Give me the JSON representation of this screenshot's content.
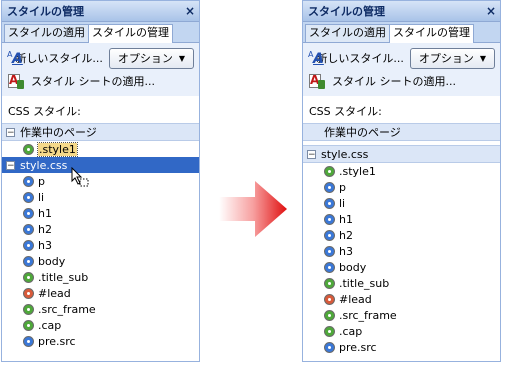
{
  "panel_title": "スタイルの管理",
  "close_symbol": "×",
  "tabs": [
    "スタイルの適用",
    "スタイルの管理"
  ],
  "new_style_label": "新しいスタイル...",
  "options_label": "オプション",
  "apply_stylesheet_label": "スタイル シートの適用...",
  "css_styles_label": "CSS スタイル:",
  "current_page_group": "作業中のページ",
  "stylesheet_group": "style.css",
  "toggle_collapse": "−",
  "colors": {
    "blue": "#3a78d8",
    "green": "#4ea83a",
    "red": "#d85a3a",
    "selection": "#3168c6"
  },
  "left": {
    "current_page_items": [
      {
        "label": ".style1",
        "color": "green"
      }
    ],
    "stylesheet_items": [
      {
        "label": "p",
        "color": "blue"
      },
      {
        "label": "li",
        "color": "blue"
      },
      {
        "label": "h1",
        "color": "blue"
      },
      {
        "label": "h2",
        "color": "blue"
      },
      {
        "label": "h3",
        "color": "blue"
      },
      {
        "label": "body",
        "color": "blue"
      },
      {
        "label": ".title_sub",
        "color": "green"
      },
      {
        "label": "#lead",
        "color": "red"
      },
      {
        "label": ".src_frame",
        "color": "green"
      },
      {
        "label": ".cap",
        "color": "green"
      },
      {
        "label": "pre.src",
        "color": "blue"
      }
    ]
  },
  "right": {
    "stylesheet_items": [
      {
        "label": ".style1",
        "color": "green"
      },
      {
        "label": "p",
        "color": "blue"
      },
      {
        "label": "li",
        "color": "blue"
      },
      {
        "label": "h1",
        "color": "blue"
      },
      {
        "label": "h2",
        "color": "blue"
      },
      {
        "label": "h3",
        "color": "blue"
      },
      {
        "label": "body",
        "color": "blue"
      },
      {
        "label": ".title_sub",
        "color": "green"
      },
      {
        "label": "#lead",
        "color": "red"
      },
      {
        "label": ".src_frame",
        "color": "green"
      },
      {
        "label": ".cap",
        "color": "green"
      },
      {
        "label": "pre.src",
        "color": "blue"
      }
    ]
  }
}
